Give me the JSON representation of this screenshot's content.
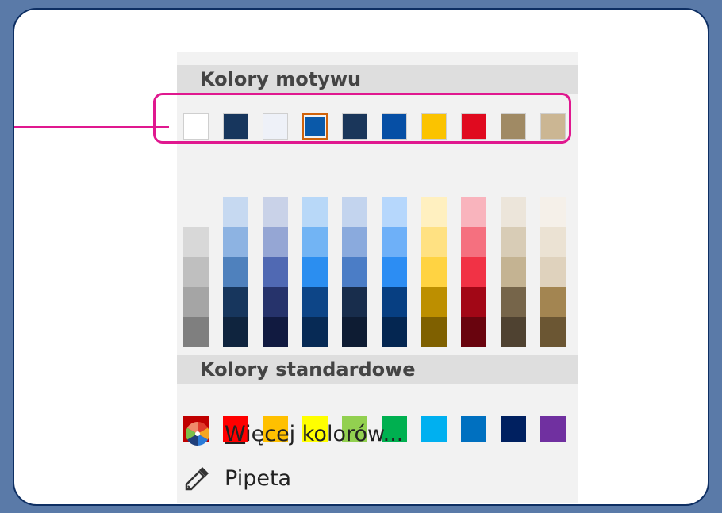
{
  "theme": {
    "heading": "Kolory motywu",
    "base_colors": [
      "#ffffff",
      "#17365d",
      "#eef1f8",
      "#0a59a9",
      "#1a365a",
      "#064fa5",
      "#fbc300",
      "#e00a1f",
      "#a08a64",
      "#cbb693"
    ],
    "selected_index": 3,
    "shades": [
      [
        "#f2f2f2",
        "#d8d8d8",
        "#bfbfbf",
        "#a5a5a5",
        "#7f7f7f"
      ],
      [
        "#c6d9f1",
        "#8db3e2",
        "#4f81bd",
        "#17365d",
        "#0f243e"
      ],
      [
        "#c9d2e8",
        "#95a6d4",
        "#5069b3",
        "#26336b",
        "#111a40"
      ],
      [
        "#b8d8f8",
        "#72b4f4",
        "#2b8ef0",
        "#0d4587",
        "#072a55"
      ],
      [
        "#c3d4ee",
        "#8aaadd",
        "#4b7dc6",
        "#182d4c",
        "#0e1c33"
      ],
      [
        "#b6d7fc",
        "#6eb0f8",
        "#2c8df3",
        "#073f82",
        "#042651"
      ],
      [
        "#fff0c0",
        "#ffe182",
        "#ffd342",
        "#bd8f00",
        "#7f6000"
      ],
      [
        "#f9b4bd",
        "#f5707f",
        "#f13245",
        "#a20716",
        "#69040e"
      ],
      [
        "#ece5da",
        "#d8ccb6",
        "#c4b392",
        "#76654a",
        "#4f4231"
      ],
      [
        "#f5f0e9",
        "#ebe2d3",
        "#dfd2bd",
        "#a38551",
        "#6b5633"
      ]
    ]
  },
  "standard": {
    "heading": "Kolory standardowe",
    "colors": [
      "#c00000",
      "#ff0000",
      "#ffc000",
      "#ffff00",
      "#92d050",
      "#00b050",
      "#00b0f0",
      "#0070c0",
      "#002060",
      "#7030a0"
    ]
  },
  "menu": {
    "more_colors": "Więcej kolorów...",
    "eyedropper": "Pipeta"
  },
  "accent": "#e0188f"
}
